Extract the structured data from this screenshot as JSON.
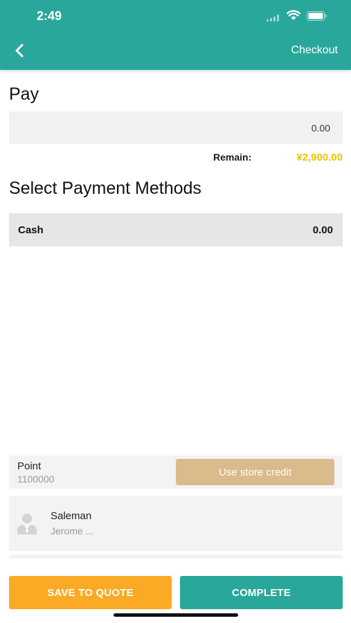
{
  "status_bar": {
    "time": "2:49"
  },
  "header": {
    "title": "Checkout",
    "back_icon": "chevron-left-icon"
  },
  "pay": {
    "label": "Pay",
    "amount": "0.00"
  },
  "remain": {
    "label": "Remain:",
    "value": "¥2,900.00"
  },
  "payment_methods": {
    "title": "Select Payment Methods",
    "items": [
      {
        "name": "Cash",
        "amount": "0.00"
      }
    ]
  },
  "point": {
    "label": "Point",
    "value": "1100000",
    "button_label": "Use store credit"
  },
  "salesman": {
    "label": "Saleman",
    "value": "Jerome ...",
    "icon": "person-icon"
  },
  "actions": {
    "save_label": "SAVE TO QUOTE",
    "complete_label": "COMPLETE"
  },
  "colors": {
    "primary": "#2aa79b",
    "accent": "#fbaa25",
    "remain": "#f2c200",
    "credit": "#d9bb8c"
  }
}
